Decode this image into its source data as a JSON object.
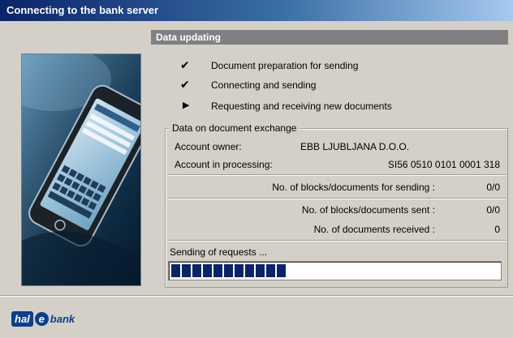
{
  "window": {
    "title": "Connecting to the bank server"
  },
  "section": {
    "title": "Data updating"
  },
  "steps": [
    {
      "status": "done",
      "icon": "check-icon",
      "label": "Document preparation for sending"
    },
    {
      "status": "done",
      "icon": "check-icon",
      "label": "Connecting and sending"
    },
    {
      "status": "in-progress",
      "icon": "arrow-right-icon",
      "label": "Requesting and receiving new documents"
    }
  ],
  "exchange": {
    "group_title": "Data on document exchange",
    "account_owner_label": "Account owner:",
    "account_owner_value": "EBB LJUBLJANA D.O.O.",
    "account_processing_label": "Account in processing:",
    "account_processing_value": "SI56 0510 0101 0001 318",
    "blocks_for_sending_label": "No. of blocks/documents for sending :",
    "blocks_for_sending_value": "0/0",
    "blocks_sent_label": "No. of blocks/documents sent :",
    "blocks_sent_value": "0/0",
    "docs_received_label": "No. of documents received :",
    "docs_received_value": "0",
    "status_text": "Sending of requests ...",
    "progress_fraction": 0.35
  },
  "logo": {
    "part1": "hal",
    "part2": "e",
    "part3": "bank"
  },
  "colors": {
    "title_bar": "#0a246a",
    "progress": "#0a246a",
    "section_header": "#808080",
    "background": "#d4d0c8"
  }
}
